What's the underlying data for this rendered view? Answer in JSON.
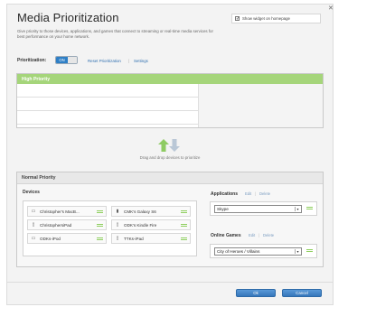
{
  "page": {
    "title": "Media Prioritization",
    "description": "Give priority to those devices, applications, and games that connect to streaming or real-time media services for best performance on your home network.",
    "close_icon": "close-icon"
  },
  "widget": {
    "label": "Show widget on homepage",
    "checked": true
  },
  "prioritization": {
    "label": "Prioritization:",
    "toggle_label": "ON",
    "toggle_state": "on",
    "reset_link": "Reset Prioritization",
    "settings_link": "Settings"
  },
  "high_priority": {
    "title": "High Priority",
    "rows": 3
  },
  "drag": {
    "text": "Drag and drop devices to prioritize"
  },
  "normal_priority": {
    "title": "Normal Priority",
    "devices_label": "Devices",
    "devices": [
      {
        "name": "Christopher's MacB...",
        "icon": "laptop-icon"
      },
      {
        "name": "CMK's Galaxy S6",
        "icon": "phone-icon"
      },
      {
        "name": "ChristophersiPad",
        "icon": "tablet-icon"
      },
      {
        "name": "ODK's Kindle Fire",
        "icon": "tablet-icon"
      },
      {
        "name": "ODKs-iPod",
        "icon": "laptop-icon"
      },
      {
        "name": "TTKs-iPad",
        "icon": "tablet-icon"
      }
    ],
    "applications": {
      "label": "Applications",
      "edit": "Edit",
      "delete": "Delete",
      "selected": "Skype"
    },
    "online_games": {
      "label": "Online Games",
      "edit": "Edit",
      "delete": "Delete",
      "selected": "City of Heroes / Villains"
    }
  },
  "footer": {
    "ok_label": "Ok",
    "cancel_label": "Cancel"
  },
  "colors": {
    "accent": "#2e7fc6",
    "high_priority_header": "#a5d57a",
    "grip": "#8fcf5f"
  }
}
